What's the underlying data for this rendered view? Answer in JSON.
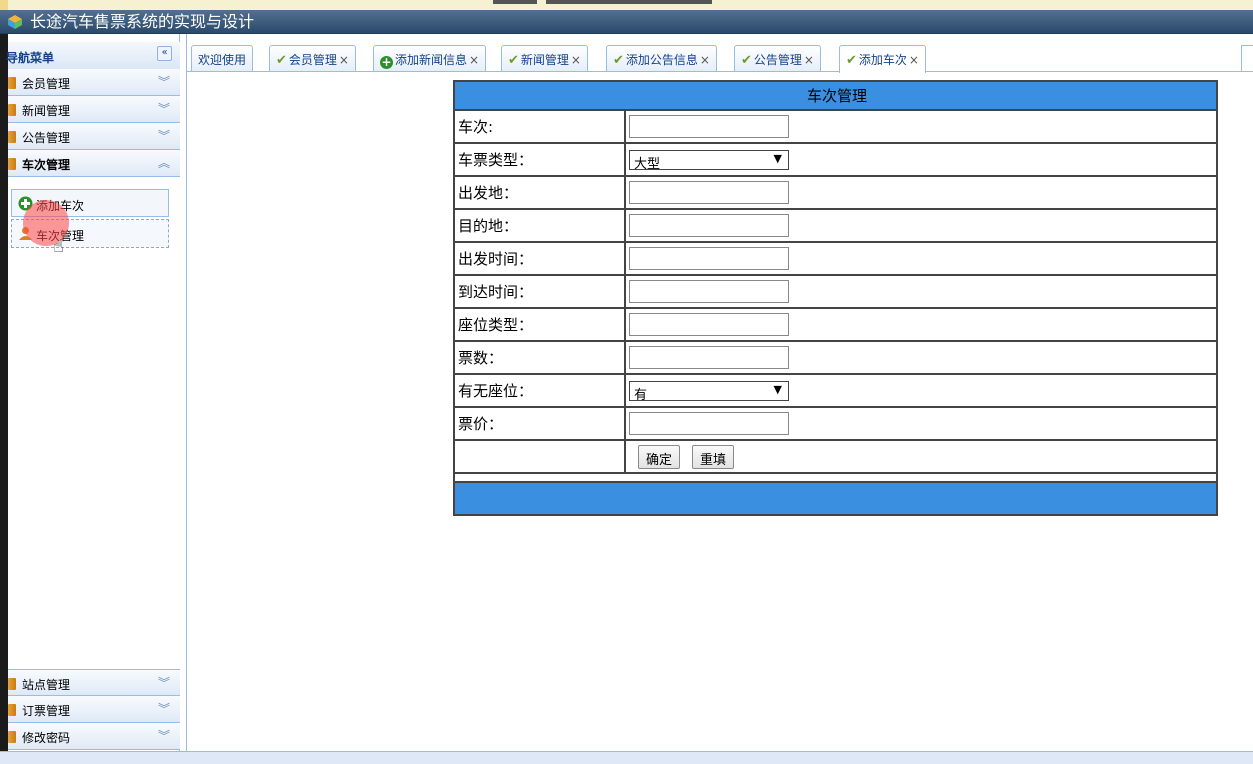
{
  "app": {
    "title": "长途汽车售票系统的实现与设计"
  },
  "sidebar": {
    "header": "导航菜单",
    "collapse_icon": "«",
    "sections_top": [
      {
        "label": "会员管理",
        "chevron": "︾"
      },
      {
        "label": "新闻管理",
        "chevron": "︾"
      },
      {
        "label": "公告管理",
        "chevron": "︾"
      },
      {
        "label": "车次管理",
        "chevron": "︽"
      }
    ],
    "sub_items": [
      {
        "label": "添加车次",
        "icon": "plus-icon"
      },
      {
        "label": "车次管理",
        "icon": "user-icon"
      }
    ],
    "sections_bottom": [
      {
        "label": "站点管理",
        "chevron": "︾"
      },
      {
        "label": "订票管理",
        "chevron": "︾"
      },
      {
        "label": "修改密码",
        "chevron": "︾"
      }
    ]
  },
  "tabs": [
    {
      "label": "欢迎使用",
      "icon": "",
      "closable": false
    },
    {
      "label": "会员管理",
      "icon": "check",
      "closable": true
    },
    {
      "label": "添加新闻信息",
      "icon": "plus",
      "closable": true
    },
    {
      "label": "新闻管理",
      "icon": "check",
      "closable": true
    },
    {
      "label": "添加公告信息",
      "icon": "check",
      "closable": true
    },
    {
      "label": "公告管理",
      "icon": "check",
      "closable": true
    },
    {
      "label": "添加车次",
      "icon": "check",
      "closable": true,
      "active": true
    }
  ],
  "form": {
    "title": "车次管理",
    "fields": {
      "trip_no": {
        "label": "车次:",
        "value": ""
      },
      "ticket_type": {
        "label": "车票类型：",
        "value": "大型"
      },
      "departure": {
        "label": "出发地：",
        "value": ""
      },
      "destination": {
        "label": "目的地：",
        "value": ""
      },
      "depart_time": {
        "label": "出发时间：",
        "value": ""
      },
      "arrive_time": {
        "label": "到达时间：",
        "value": ""
      },
      "seat_type": {
        "label": "座位类型：",
        "value": ""
      },
      "ticket_count": {
        "label": "票数：",
        "value": ""
      },
      "has_seat": {
        "label": "有无座位：",
        "value": "有"
      },
      "price": {
        "label": "票价：",
        "value": ""
      }
    },
    "submit_label": "确定",
    "reset_label": "重填"
  },
  "colors": {
    "header_bg": "#2b4a6b",
    "table_header_bg": "#3a8fe0",
    "border": "#99bbe8"
  }
}
